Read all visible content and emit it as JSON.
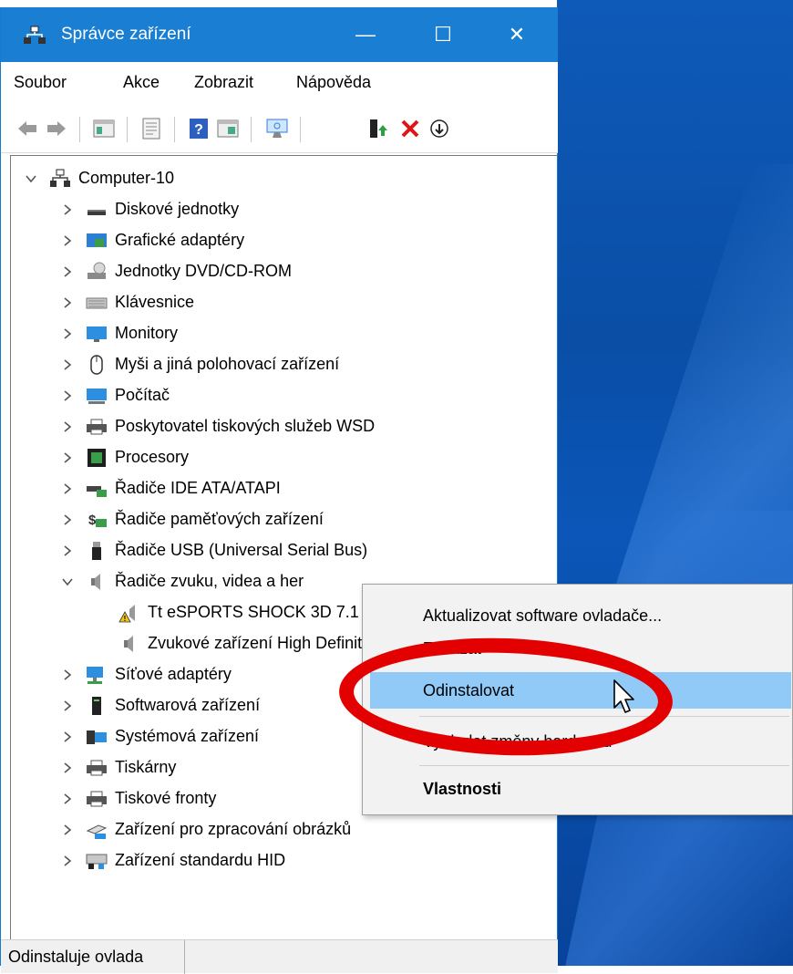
{
  "window": {
    "title": "Správce zařízení",
    "minimize_symbol": "—",
    "maximize_symbol": "☐",
    "close_symbol": "✕"
  },
  "menu": [
    "Soubor",
    "Akce",
    "Zobrazit",
    "Nápověda"
  ],
  "toolbar": {
    "icons": [
      "back-arrow-icon",
      "forward-arrow-icon",
      "properties-view-icon",
      "properties-icon",
      "help-icon",
      "action-view-icon",
      "scan-hardware-icon",
      "update-driver-icon",
      "uninstall-icon",
      "disable-device-icon"
    ]
  },
  "tree": {
    "root": "Computer-10",
    "categories": [
      {
        "label": "Diskové jednotky",
        "icon": "disk-drive-icon"
      },
      {
        "label": "Grafické adaptéry",
        "icon": "display-adapter-icon"
      },
      {
        "label": "Jednotky DVD/CD-ROM",
        "icon": "dvd-drive-icon"
      },
      {
        "label": "Klávesnice",
        "icon": "keyboard-icon"
      },
      {
        "label": "Monitory",
        "icon": "monitor-icon"
      },
      {
        "label": "Myši a jiná polohovací zařízení",
        "icon": "mouse-icon"
      },
      {
        "label": "Počítač",
        "icon": "computer-icon"
      },
      {
        "label": "Poskytovatel tiskových služeb WSD",
        "icon": "printer-icon"
      },
      {
        "label": "Procesory",
        "icon": "processor-icon"
      },
      {
        "label": "Řadiče IDE ATA/ATAPI",
        "icon": "ide-controller-icon"
      },
      {
        "label": "Řadiče paměťových zařízení",
        "icon": "storage-controller-icon"
      },
      {
        "label": "Řadiče USB (Universal Serial Bus)",
        "icon": "usb-icon"
      },
      {
        "label": "Řadiče zvuku, videa a her",
        "icon": "speaker-icon"
      }
    ],
    "sound_children": [
      {
        "label": "Tt eSPORTS SHOCK 3D 7.1",
        "icon": "warning-speaker-icon"
      },
      {
        "label": "Zvukové zařízení High Definition",
        "icon": "speaker-icon"
      }
    ],
    "categories_after": [
      {
        "label": "Síťové adaptéry",
        "icon": "network-adapter-icon"
      },
      {
        "label": "Softwarová zařízení",
        "icon": "software-device-icon"
      },
      {
        "label": "Systémová zařízení",
        "icon": "system-device-icon"
      },
      {
        "label": "Tiskárny",
        "icon": "printer-icon"
      },
      {
        "label": "Tiskové fronty",
        "icon": "printer-icon"
      },
      {
        "label": "Zařízení pro zpracování obrázků",
        "icon": "imaging-device-icon"
      },
      {
        "label": "Zařízení standardu HID",
        "icon": "hid-device-icon"
      }
    ]
  },
  "context_menu": {
    "update_driver": "Aktualizovat software ovladače...",
    "disable": "Zakázat",
    "uninstall": "Odinstalovat",
    "scan": "Vyhledat změny hardwaru",
    "properties": "Vlastnosti"
  },
  "status": {
    "text": "Odinstaluje ovlada"
  },
  "colors": {
    "titlebar": "#1a7ed2",
    "highlight": "#91c9f7",
    "annotation_red": "#e20000"
  }
}
